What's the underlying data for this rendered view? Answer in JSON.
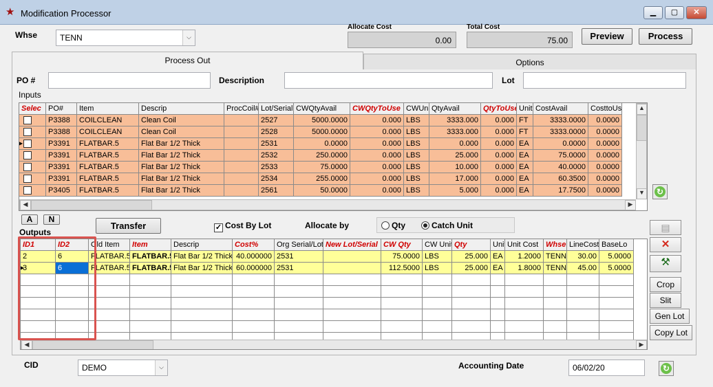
{
  "window": {
    "title": "Modification Processor",
    "minimize": "▁",
    "maximize": "▢",
    "close": "✕"
  },
  "header": {
    "whse_label": "Whse",
    "whse_value": "TENN",
    "allocate_cost_label": "Allocate Cost",
    "allocate_cost_value": "0.00",
    "total_cost_label": "Total Cost",
    "total_cost_value": "75.00",
    "preview_label": "Preview",
    "process_label": "Process"
  },
  "tabs": [
    {
      "label": "Process Out"
    },
    {
      "label": "Options"
    }
  ],
  "filters": {
    "po_label": "PO #",
    "description_label": "Description",
    "lot_label": "Lot"
  },
  "inputs": {
    "title": "Inputs",
    "columns": [
      "Selec",
      "PO#",
      "Item",
      "Descrip",
      "ProcCoil#",
      "Lot/Serial",
      "CWQtyAvail",
      "CWQtyToUse",
      "CWUnit",
      "QtyAvail",
      "QtyToUse",
      "Unit",
      "CostAvail",
      "CosttoUs"
    ],
    "red_columns": [
      0,
      7,
      10
    ],
    "rows": [
      [
        "",
        "P3388",
        "COILCLEAN",
        "Clean Coil",
        "",
        "2527",
        "5000.0000",
        "0.000",
        "LBS",
        "3333.000",
        "0.000",
        "FT",
        "3333.0000",
        "0.0000"
      ],
      [
        "",
        "P3388",
        "COILCLEAN",
        "Clean Coil",
        "",
        "2528",
        "5000.0000",
        "0.000",
        "LBS",
        "3333.000",
        "0.000",
        "FT",
        "3333.0000",
        "0.0000"
      ],
      [
        "",
        "P3391",
        "FLATBAR.5",
        "Flat Bar 1/2 Thick",
        "",
        "2531",
        "0.0000",
        "0.000",
        "LBS",
        "0.000",
        "0.000",
        "EA",
        "0.0000",
        "0.0000"
      ],
      [
        "",
        "P3391",
        "FLATBAR.5",
        "Flat Bar 1/2 Thick",
        "",
        "2532",
        "250.0000",
        "0.000",
        "LBS",
        "25.000",
        "0.000",
        "EA",
        "75.0000",
        "0.0000"
      ],
      [
        "",
        "P3391",
        "FLATBAR.5",
        "Flat Bar 1/2 Thick",
        "",
        "2533",
        "75.0000",
        "0.000",
        "LBS",
        "10.000",
        "0.000",
        "EA",
        "40.0000",
        "0.0000"
      ],
      [
        "",
        "P3391",
        "FLATBAR.5",
        "Flat Bar 1/2 Thick",
        "",
        "2534",
        "255.0000",
        "0.000",
        "LBS",
        "17.000",
        "0.000",
        "EA",
        "60.3500",
        "0.0000"
      ],
      [
        "",
        "P3405",
        "FLATBAR.5",
        "Flat Bar 1/2 Thick",
        "",
        "2561",
        "50.0000",
        "0.000",
        "LBS",
        "5.000",
        "0.000",
        "EA",
        "17.7500",
        "0.0000"
      ]
    ],
    "current_row": 2
  },
  "mid": {
    "a_label": "A",
    "n_label": "N",
    "transfer_label": "Transfer",
    "cost_by_lot_label": "Cost By Lot",
    "allocate_by_label": "Allocate by",
    "qty_label": "Qty",
    "catch_unit_label": "Catch Unit",
    "checkmark": "✓"
  },
  "outputs": {
    "title": "Outputs",
    "columns": [
      "ID1",
      "ID2",
      "Old Item",
      "Item",
      "Descrip",
      "Cost%",
      "Org Serial/Lot",
      "New Lot/Serial",
      "CW Qty",
      "CW Unit",
      "Qty",
      "Unit",
      "Unit Cost",
      "Whse",
      "LineCost",
      "BaseLo"
    ],
    "red_columns": [
      0,
      1,
      3,
      5,
      7,
      8,
      10,
      13
    ],
    "rows": [
      [
        "2",
        "6",
        "FLATBAR.5",
        "FLATBAR.5",
        "Flat Bar 1/2 Thick",
        "40.000000",
        "2531",
        "",
        "75.0000",
        "LBS",
        "25.000",
        "EA",
        "1.2000",
        "TENN",
        "30.00",
        "5.0000"
      ],
      [
        "3",
        "6",
        "FLATBAR.5",
        "FLATBAR.5",
        "Flat Bar 1/2 Thick",
        "60.000000",
        "2531",
        "",
        "112.5000",
        "LBS",
        "25.000",
        "EA",
        "1.8000",
        "TENN",
        "45.00",
        "5.0000"
      ]
    ],
    "current_row": 1
  },
  "side_buttons": {
    "crop": "Crop",
    "slit": "Slit",
    "gen_lot": "Gen Lot",
    "copy_lot": "Copy Lot",
    "delete_icon": "✕",
    "paste_icon": "▤",
    "tool_icon": "⚒"
  },
  "footer": {
    "cid_label": "CID",
    "cid_value": "DEMO",
    "accounting_date_label": "Accounting Date",
    "accounting_date_value": "06/02/20"
  },
  "icons": {
    "refresh": "↻",
    "combo_arrow": "⌵",
    "row_marker": "▶",
    "scroll_up": "▲",
    "scroll_down": "▼",
    "scroll_left": "◀",
    "scroll_right": "▶"
  },
  "colors": {
    "input_row": "#f8be98",
    "output_row": "#ffff99",
    "selected_cell": "#0a6fd6",
    "highlight_box": "#d9534f",
    "header_red": "#d00000"
  }
}
